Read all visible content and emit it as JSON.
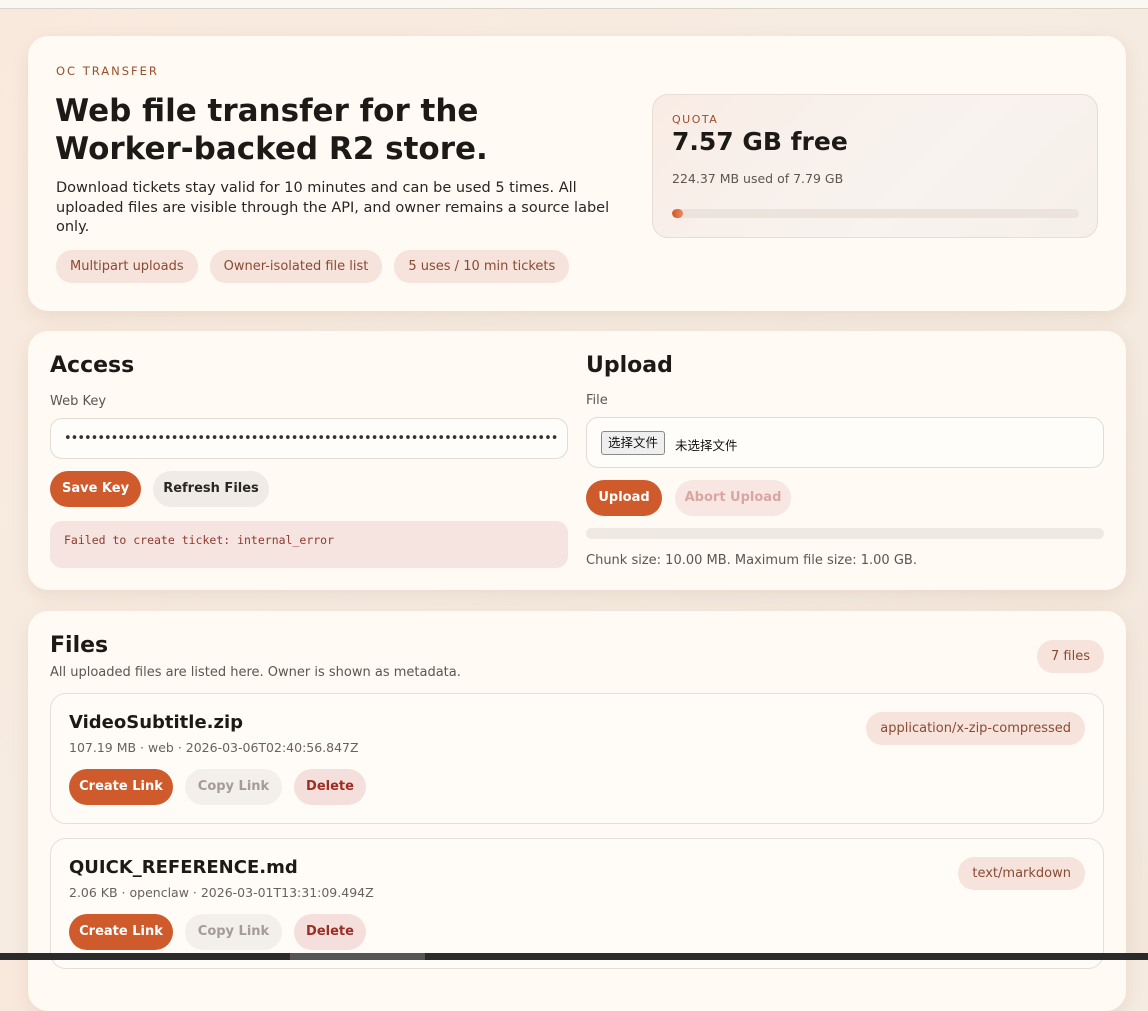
{
  "hero": {
    "eyebrow": "OC TRANSFER",
    "title": "Web file transfer for the Worker-backed R2 store.",
    "description": "Download tickets stay valid for 10 minutes and can be used 5 times. All uploaded files are visible through the API, and owner remains a source label only.",
    "chips": [
      "Multipart uploads",
      "Owner-isolated file list",
      "5 uses / 10 min tickets"
    ]
  },
  "quota": {
    "label": "QUOTA",
    "free": "7.57 GB free",
    "used": "224.37 MB used of 7.79 GB",
    "used_fraction": 0.028
  },
  "access": {
    "title": "Access",
    "key_label": "Web Key",
    "key_value": "••••••••••••••••••••••••••••••••••••••••••••••••••••••••••••••••••••••••••",
    "save_label": "Save Key",
    "refresh_label": "Refresh Files",
    "error": "Failed to create ticket: internal_error"
  },
  "upload": {
    "title": "Upload",
    "file_label": "File",
    "choose_label": "选择文件",
    "no_file": "未选择文件",
    "upload_label": "Upload",
    "abort_label": "Abort Upload",
    "chunk_info": "Chunk size: 10.00 MB. Maximum file size: 1.00 GB."
  },
  "files": {
    "title": "Files",
    "subtitle": "All uploaded files are listed here. Owner is shown as metadata.",
    "count": "7 files",
    "create_label": "Create Link",
    "copy_label": "Copy Link",
    "delete_label": "Delete",
    "items": [
      {
        "name": "VideoSubtitle.zip",
        "meta": "107.19 MB · web · 2026-03-06T02:40:56.847Z",
        "type": "application/x-zip-compressed"
      },
      {
        "name": "QUICK_REFERENCE.md",
        "meta": "2.06 KB · openclaw · 2026-03-01T13:31:09.494Z",
        "type": "text/markdown"
      }
    ]
  },
  "colors": {
    "accent": "#cf5a2c",
    "background": "#f6ece2",
    "card": "#fffaf4"
  }
}
